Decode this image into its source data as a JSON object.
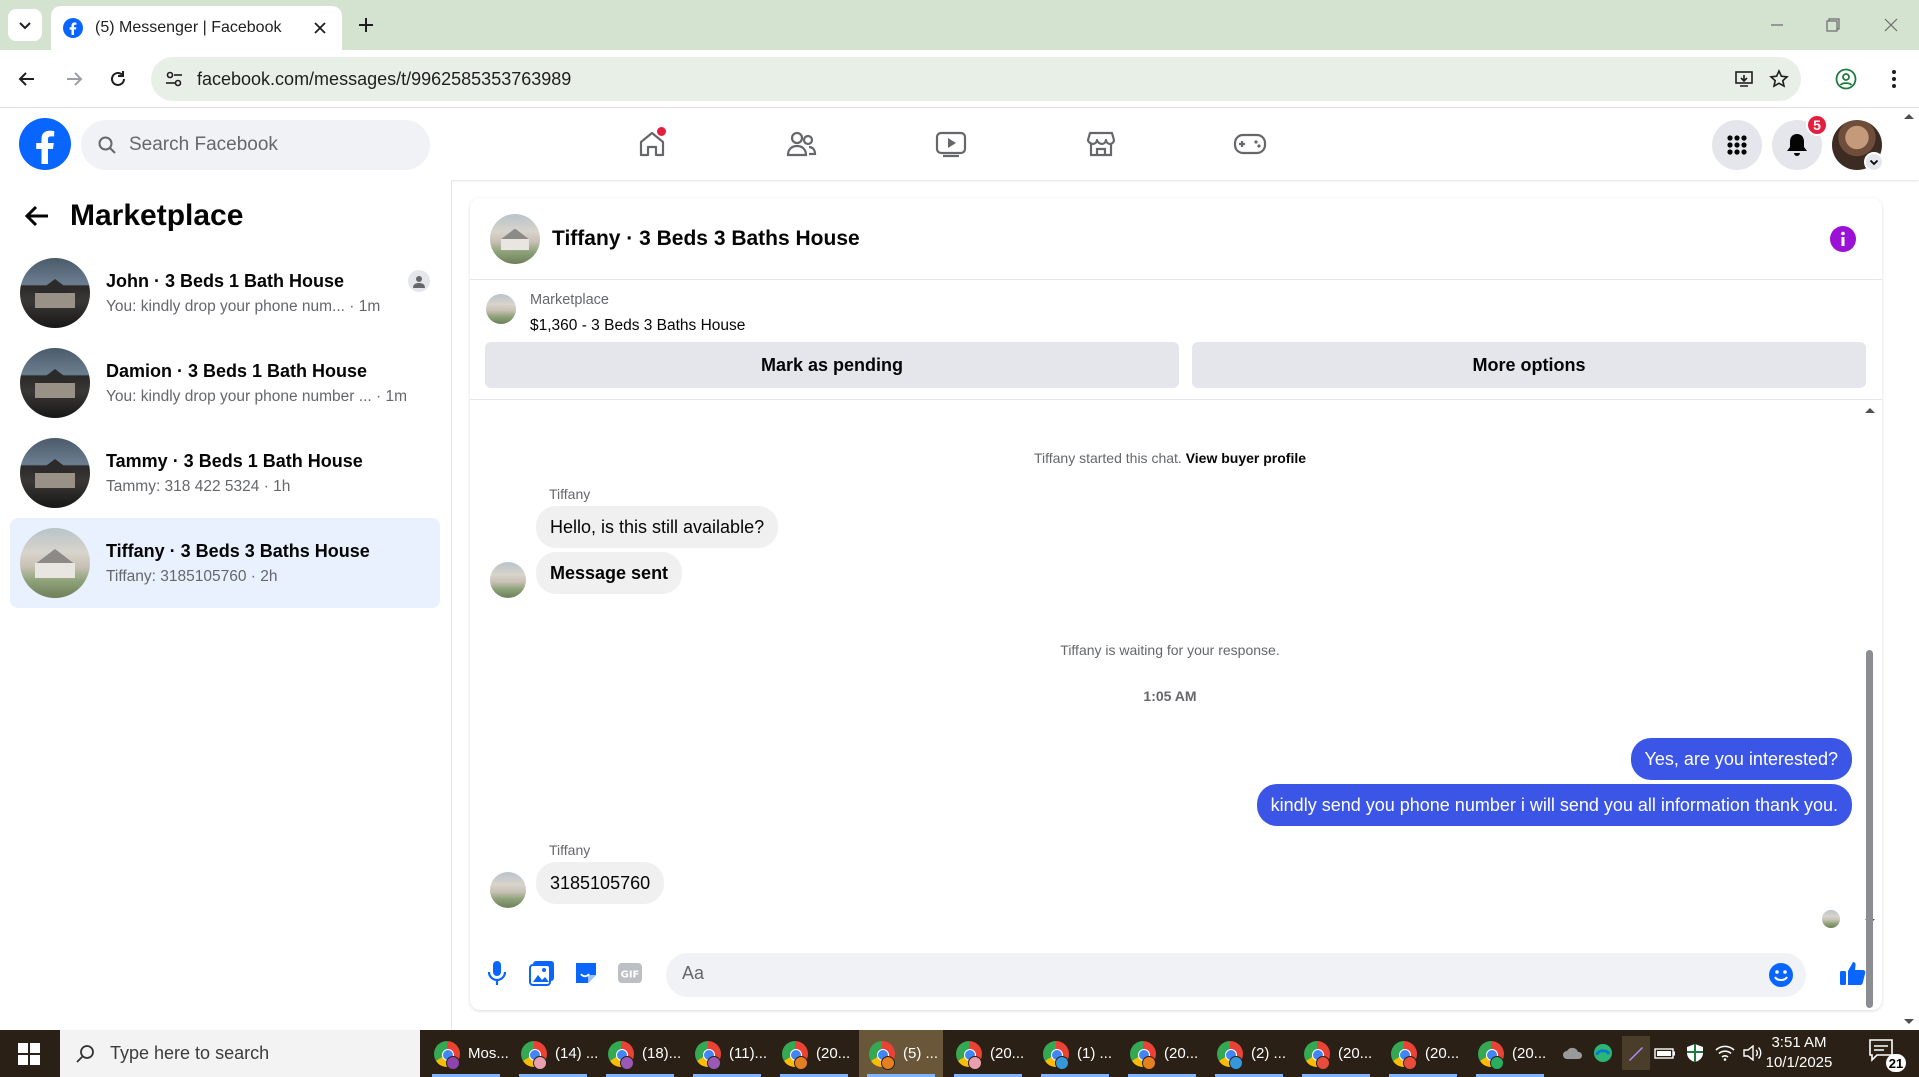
{
  "browser": {
    "tab_title": "(5) Messenger | Facebook",
    "url": "facebook.com/messages/t/9962585353763989"
  },
  "fb": {
    "search_placeholder": "Search Facebook",
    "notification_count": "5",
    "accent_color": "#0866ff"
  },
  "left_panel": {
    "title": "Marketplace",
    "conversations": [
      {
        "name": "John · 3 Beds 1 Bath House",
        "preview": "You: kindly drop your phone num...",
        "time": "· 1m"
      },
      {
        "name": "Damion · 3 Beds 1 Bath House",
        "preview": "You: kindly drop your phone number ...",
        "time": "· 1m"
      },
      {
        "name": "Tammy · 3 Beds 1 Bath House",
        "preview": "Tammy: 318 422 5324",
        "time": "· 1h"
      },
      {
        "name": "Tiffany · 3 Beds 3 Baths House",
        "preview": "Tiffany: 3185105760",
        "time": "· 2h"
      }
    ]
  },
  "chat": {
    "title": "Tiffany · 3 Beds 3 Baths House",
    "listing_label": "Marketplace",
    "listing_price": "$1,360 - 3 Beds 3 Baths House",
    "mark_pending": "Mark as pending",
    "more_options": "More options",
    "started_text": "Tiffany started this chat.",
    "view_profile": "View buyer profile",
    "sender_name": "Tiffany",
    "msg1": "Hello, is this still available?",
    "msg2": "Message sent",
    "waiting_text": "Tiffany is waiting for your response.",
    "timestamp": "1:05 AM",
    "out1": "Yes, are you interested?",
    "out2": "kindly send you phone number i will send you all information thank you.",
    "msg3": "3185105760",
    "composer_placeholder": "Aa",
    "outgoing_color": "#3b55e6"
  },
  "taskbar": {
    "search_placeholder": "Type here to search",
    "apps": [
      {
        "label": "Mos..."
      },
      {
        "label": "(14) ..."
      },
      {
        "label": "(18)..."
      },
      {
        "label": "(11)..."
      },
      {
        "label": "(20..."
      },
      {
        "label": "(5) ..."
      },
      {
        "label": "(20..."
      },
      {
        "label": "(1) ..."
      },
      {
        "label": "(20..."
      },
      {
        "label": "(2) ..."
      },
      {
        "label": "(20..."
      },
      {
        "label": "(20..."
      },
      {
        "label": "(20..."
      }
    ],
    "time": "3:51 AM",
    "date": "10/1/2025",
    "notification_count": "21"
  }
}
